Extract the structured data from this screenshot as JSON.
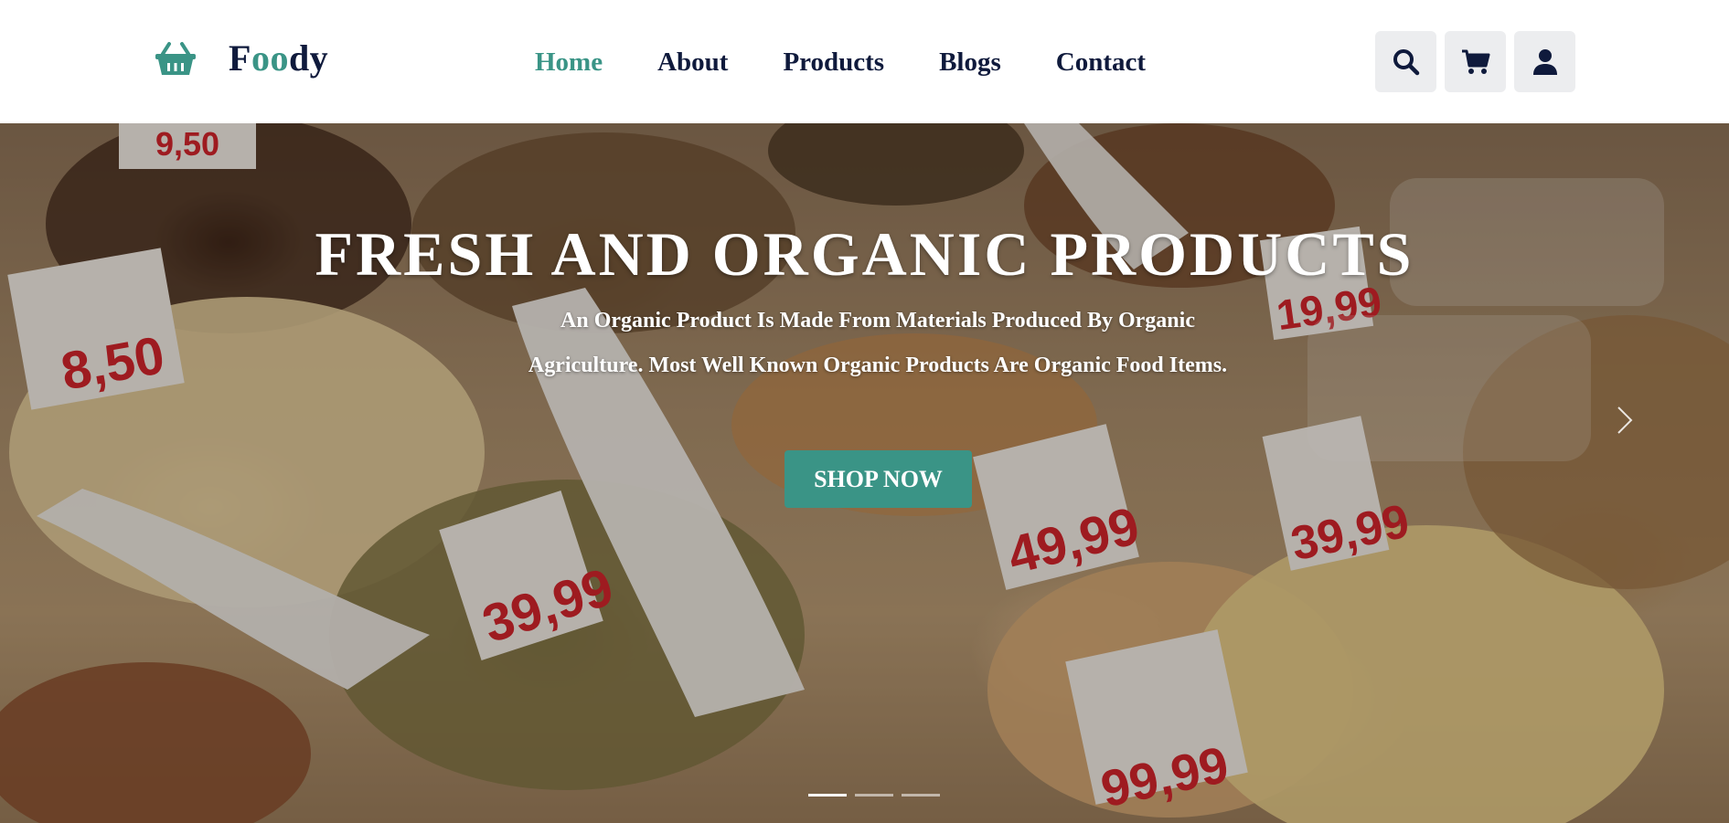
{
  "brand": {
    "name_first": "F",
    "name_accent": "oo",
    "name_last": "dy",
    "icon": "shopping-basket-icon"
  },
  "nav": {
    "items": [
      {
        "label": "Home",
        "active": true
      },
      {
        "label": "About",
        "active": false
      },
      {
        "label": "Products",
        "active": false
      },
      {
        "label": "Blogs",
        "active": false
      },
      {
        "label": "Contact",
        "active": false
      }
    ]
  },
  "actions": {
    "icons": [
      "search-icon",
      "cart-icon",
      "user-icon"
    ]
  },
  "hero": {
    "title": "FRESH AND ORGANIC PRODUCTS",
    "description": "An Organic Product Is Made From Materials Produced By Organic Agriculture. Most Well Known Organic Products Are Organic Food Items.",
    "cta_label": "SHOP NOW",
    "slides_total": 3,
    "active_slide": 1
  },
  "colors": {
    "accent": "#3a9486",
    "navy": "#0f1a3c",
    "action_bg": "#ecedef"
  }
}
